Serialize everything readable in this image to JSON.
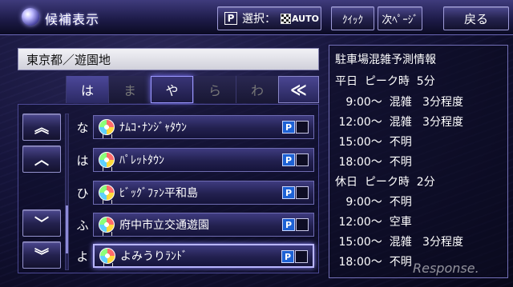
{
  "header": {
    "title": "候補表示",
    "select_label": "選択：",
    "p_label": "P",
    "auto_label": "AUTO",
    "quick_label": "ｸｲｯｸ",
    "next_page_label": "次ﾍﾟｰｼﾞ",
    "back_label": "戻る"
  },
  "area": {
    "value": "東京都／遊園地"
  },
  "kana_tabs": [
    {
      "label": "は",
      "state": "active"
    },
    {
      "label": "ま",
      "state": "disabled"
    },
    {
      "label": "や",
      "state": "selected"
    },
    {
      "label": "ら",
      "state": "disabled"
    },
    {
      "label": "わ",
      "state": "disabled"
    },
    {
      "label": "≪",
      "state": "nav"
    }
  ],
  "scroll_buttons": {
    "page_up": "︽",
    "up": "︿",
    "down": "﹀",
    "page_down": "︾"
  },
  "scroll_position": 0.85,
  "results": [
    {
      "kana": "な",
      "name": "ﾅﾑｺ･ﾅﾝｼﾞｬﾀｳﾝ",
      "parking": "P"
    },
    {
      "kana": "は",
      "name": "ﾊﾟﾚｯﾄﾀｳﾝ",
      "parking": "P"
    },
    {
      "kana": "ひ",
      "name": "ﾋﾞｯｸﾞﾌｧﾝ平和島",
      "parking": "P"
    },
    {
      "kana": "ふ",
      "name": "府中市立交通遊園",
      "parking": "P"
    },
    {
      "kana": "よ",
      "name": "よみうりﾗﾝﾄﾞ",
      "parking": "P"
    }
  ],
  "selected_index": 4,
  "info": {
    "title": "駐車場混雑予測情報",
    "lines": [
      "平日  ピーク時  5分",
      "   9:00～  混雑   3分程度",
      " 12:00～  混雑   3分程度",
      " 15:00～  不明",
      " 18:00～  不明",
      "休日  ピーク時  2分",
      "   9:00～  不明",
      " 12:00～  空車",
      " 15:00～  混雑   3分程度",
      " 18:00～  不明"
    ]
  },
  "watermark": "Response."
}
